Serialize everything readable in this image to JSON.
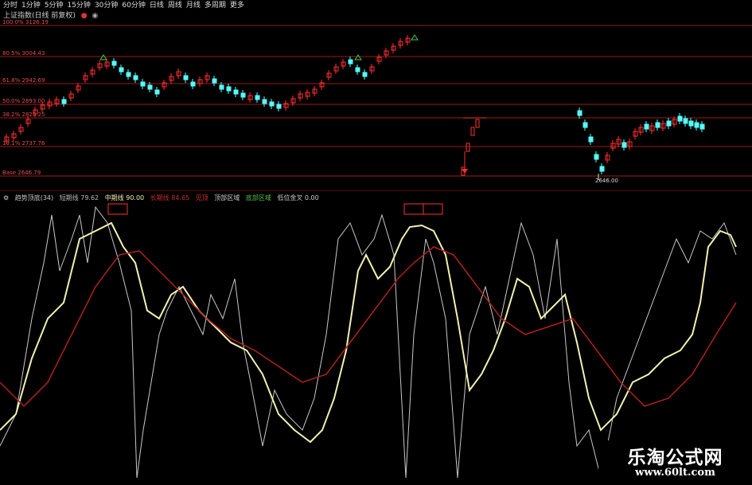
{
  "toolbar": [
    "分时",
    "1分钟",
    "5分钟",
    "15分钟",
    "30分钟",
    "60分钟",
    "日线",
    "周线",
    "月线",
    "多周期",
    "更多"
  ],
  "chart_title": "上证指数(日线 前复权)",
  "price_levels": [
    "100.0% 3126.19",
    "80.5% 3004.43",
    "61.8% 2942.69",
    "50.0% 2893.00",
    "38.2% 2826.25",
    "19.1% 2737.76",
    "Base 2646.79"
  ],
  "low_label": "2646.00",
  "indicator": {
    "name": "趋势顶底(34)",
    "items": [
      "短期线 79.62",
      "中期线 90.00",
      "长期线 84.65",
      "见顶",
      "顶部区域",
      "底部区域",
      "低位金叉 0.00"
    ]
  },
  "colors": {
    "up": "#ff3030",
    "down": "#54ffff",
    "gridline": "#a01818",
    "short_line": "#c8c8c8",
    "mid_line": "#f2f0b0",
    "long_line": "#b02020"
  },
  "watermark": {
    "cn": "乐淘公式网",
    "url": "www.60lt.com"
  }
}
